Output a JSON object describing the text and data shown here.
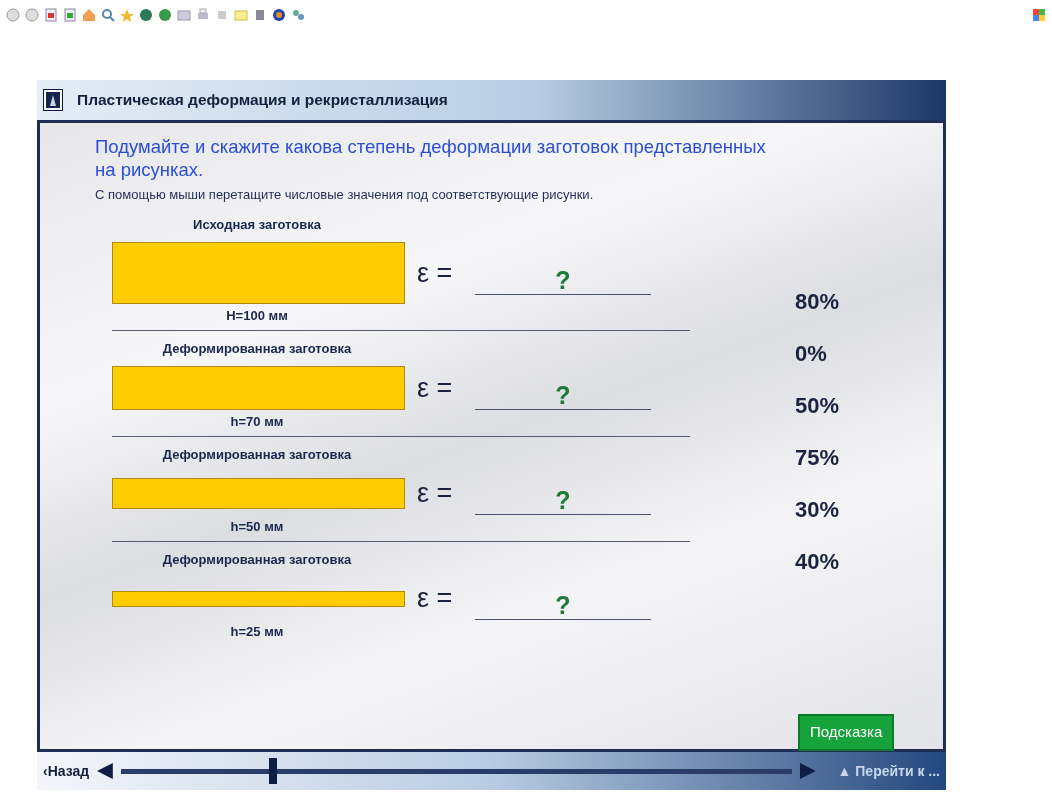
{
  "title": "Пластическая деформация и рекристаллизация",
  "question": "Подумайте и скажите какова степень деформации заготовок представленных на рисунках.",
  "instruction": "С помощью мыши перетащите числовые значения под соответствующие рисунки.",
  "workpieces": [
    {
      "label": "Исходная заготовка",
      "kind": "full",
      "formula": "ε =",
      "answer": "?",
      "height": "H=100 мм"
    },
    {
      "label": "Деформированная заготовка",
      "kind": "tall",
      "formula": "ε =",
      "answer": "?",
      "height": "h=70 мм"
    },
    {
      "label": "Деформированная заготовка",
      "kind": "medium",
      "formula": "ε =",
      "answer": "?",
      "height": "h=50 мм"
    },
    {
      "label": "Деформированная заготовка",
      "kind": "thin",
      "formula": "ε =",
      "answer": "?",
      "height": "h=25 мм"
    }
  ],
  "values": [
    "80%",
    "0%",
    "50%",
    "75%",
    "30%",
    "40%"
  ],
  "hint_button": "Подсказка",
  "nav": {
    "back": "‹Назад",
    "goto": "▲ Перейти к ...",
    "level": 0.22
  }
}
